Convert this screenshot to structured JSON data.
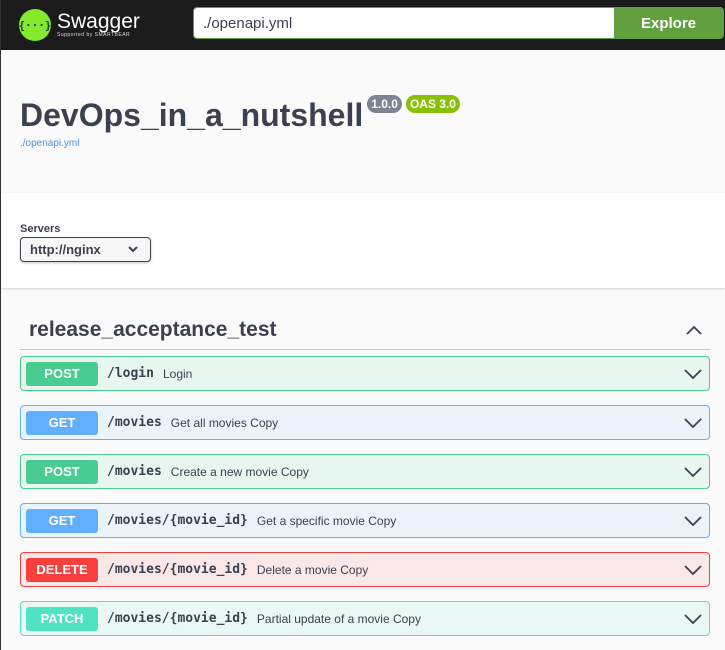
{
  "topbar": {
    "brand": "Swagger",
    "supported_by": "Supported by SMARTBEAR",
    "url_value": "./openapi.yml",
    "explore_label": "Explore"
  },
  "info": {
    "title": "DevOps_in_a_nutshell",
    "version": "1.0.0",
    "oas": "OAS 3.0",
    "spec_link": "./openapi.yml"
  },
  "servers": {
    "label": "Servers",
    "selected": "http://nginx"
  },
  "tag": {
    "name": "release_acceptance_test"
  },
  "operations": [
    {
      "method": "POST",
      "path": "/login",
      "summary": "Login",
      "color": "#49cc90",
      "bg": "#e8f6f0"
    },
    {
      "method": "GET",
      "path": "/movies",
      "summary": "Get all movies Copy",
      "color": "#61affe",
      "bg": "#ebf3fb"
    },
    {
      "method": "POST",
      "path": "/movies",
      "summary": "Create a new movie Copy",
      "color": "#49cc90",
      "bg": "#e8f6f0"
    },
    {
      "method": "GET",
      "path": "/movies/{movie_id}",
      "summary": "Get a specific movie Copy",
      "color": "#61affe",
      "bg": "#ebf3fb"
    },
    {
      "method": "DELETE",
      "path": "/movies/{movie_id}",
      "summary": "Delete a movie Copy",
      "color": "#f93e3e",
      "bg": "#fae7e7"
    },
    {
      "method": "PATCH",
      "path": "/movies/{movie_id}",
      "summary": "Partial update of a movie Copy",
      "color": "#50e3c2",
      "bg": "#e9f8f5"
    }
  ]
}
